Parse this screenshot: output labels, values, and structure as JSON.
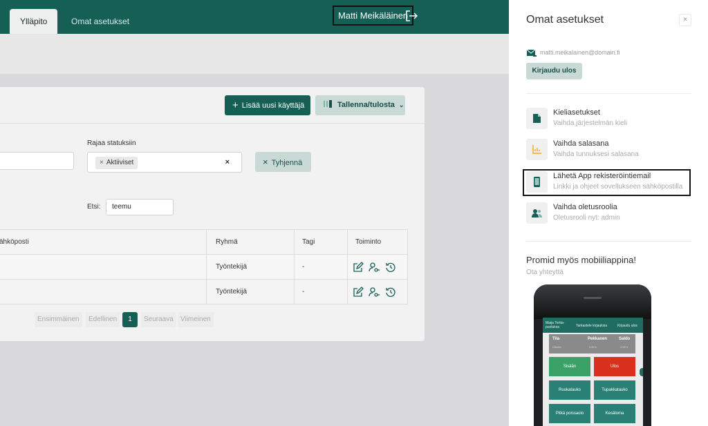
{
  "header": {
    "tabs": [
      {
        "label": "Ylläpito",
        "active": true
      },
      {
        "label": "Omat asetukset",
        "active": false
      }
    ],
    "user_name": "Matti Meikäläinen",
    "logout_icon": "logout-arrow-icon"
  },
  "toolbar": {
    "add_user_label": "Lisää uusi käyttäjä",
    "save_print_label": "Tallenna/tulosta"
  },
  "filters": {
    "status_label": "Rajaa statuksiin",
    "status_chip": "Aktiiviset",
    "clear_label": "Tyhjennä",
    "search_label": "Etsi:",
    "search_value": "teemu"
  },
  "table": {
    "columns": [
      "ähköposti",
      "Ryhmä",
      "Tagi",
      "Toiminto"
    ],
    "rows": [
      {
        "email": "",
        "group": "Työntekijä",
        "tag": "-"
      },
      {
        "email": "",
        "group": "Työntekijä",
        "tag": "-"
      }
    ]
  },
  "pagination": {
    "first": "Ensimmäinen",
    "prev": "Edellinen",
    "current": "1",
    "next": "Seuraava",
    "last": "Viimeinen"
  },
  "panel": {
    "title": "Omat asetukset",
    "close": "×",
    "email": "matti.meikalainen@domain.fi",
    "logout_label": "Kirjaudu ulos",
    "items": [
      {
        "title": "Kieliasetukset",
        "subtitle": "Vaihda järjestelmän kieli",
        "icon": "document-icon"
      },
      {
        "title": "Vaihda salasana",
        "subtitle": "Vaihda tunnuksesi salasana",
        "icon": "chart-icon"
      },
      {
        "title": "Lähetä App rekisteröintiemail",
        "subtitle": "Linkki ja ohjeet sovellukseen sähköpostilla",
        "icon": "phone-icon"
      },
      {
        "title": "Vaihda oletusroolia",
        "subtitle": "Oletusrooli nyt: admin",
        "icon": "users-icon"
      }
    ],
    "promo_title": "Promid myös mobiiliappina!",
    "promo_subtitle": "Ota yhteyttä"
  },
  "phone_screen": {
    "header_name": "Maija Tertta-puoluksa",
    "header_link1": "Tarkastele kirjauksia",
    "header_link2": "Kirjaudu ulos",
    "stat_status": "Tila",
    "stat_status_value": "Ulkona",
    "stat_day": "Pekkanen",
    "stat_day_value": "0.00 h",
    "stat_balance": "Saldo",
    "stat_balance_value": "2.00 h",
    "buttons": [
      "Sisään",
      "Ulos",
      "Ruokatauko",
      "Tupakkatauko",
      "Pitkä poissaolo",
      "Kesäloma"
    ]
  },
  "colors": {
    "brand": "#155f55",
    "brand_light": "#c9dad6",
    "danger": "#d8321e"
  }
}
